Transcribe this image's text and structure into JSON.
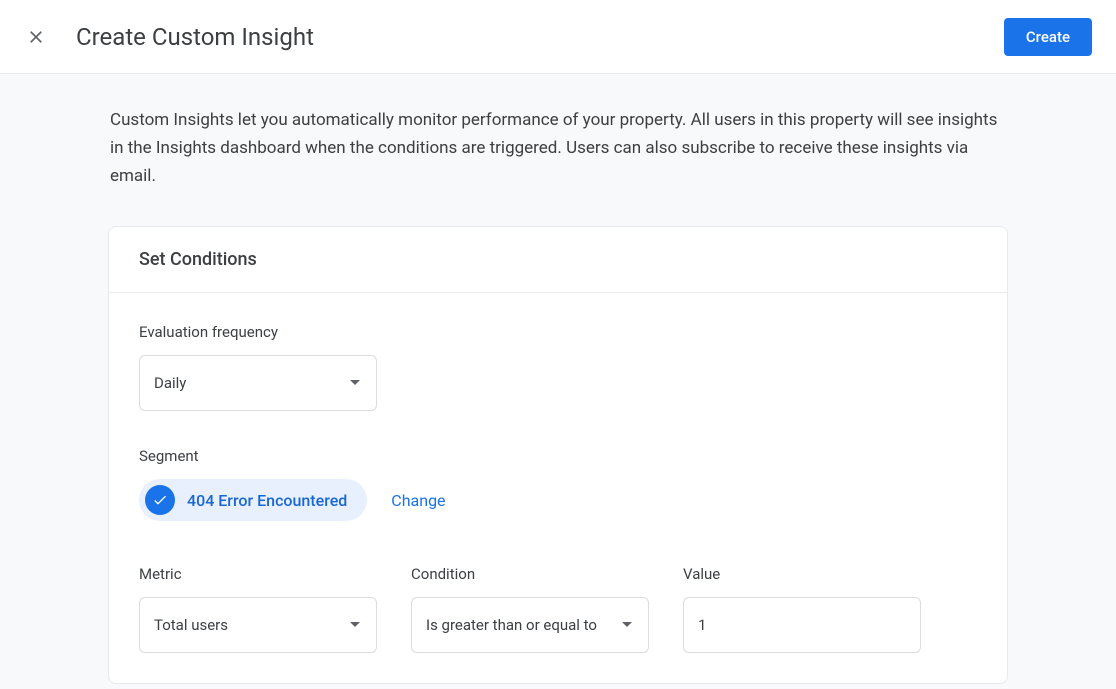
{
  "header": {
    "title": "Create Custom Insight",
    "create_label": "Create"
  },
  "description": "Custom Insights let you automatically monitor performance of your property. All users in this property will see insights in the Insights dashboard when the conditions are triggered. Users can also subscribe to receive these insights via email.",
  "card": {
    "title": "Set Conditions",
    "evaluation_frequency": {
      "label": "Evaluation frequency",
      "value": "Daily"
    },
    "segment": {
      "label": "Segment",
      "chip_label": "404 Error Encountered",
      "change_label": "Change"
    },
    "metric": {
      "label": "Metric",
      "value": "Total users"
    },
    "condition": {
      "label": "Condition",
      "value": "Is greater than or equal to"
    },
    "value": {
      "label": "Value",
      "value": "1"
    }
  }
}
